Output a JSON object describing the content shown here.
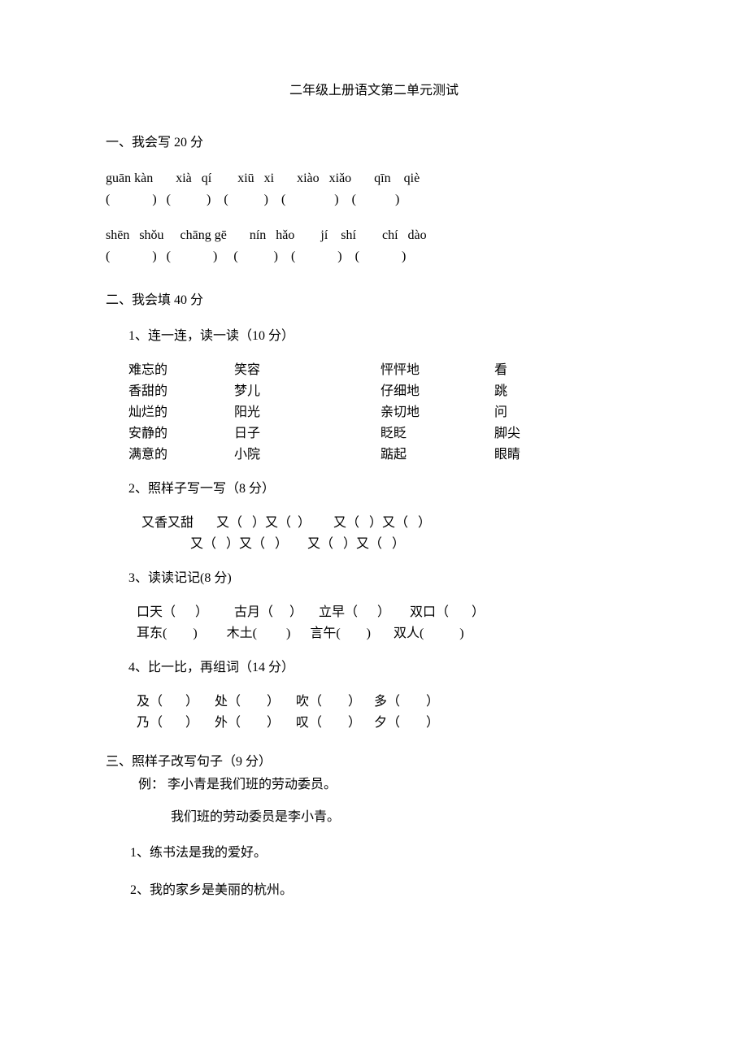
{
  "title": "二年级上册语文第二单元测试",
  "s1": {
    "heading": "一、我会写 20 分",
    "pinyin1": "guān kàn       xià   qí        xiū   xi       xiào   xiǎo       qīn    qiè",
    "blank1": "(             )   (           )    (           )    (               )    (            )",
    "pinyin2": "shēn   shǒu     chāng gē       nín   hǎo        jí    shí        chí   dào",
    "blank2": "(             )   (             )     (           )    (             )    (             )"
  },
  "s2": {
    "heading": "二、我会填  40 分",
    "q1": {
      "heading": "1、连一连，读一读（10 分）",
      "rows": [
        {
          "a": "难忘的",
          "b": "笑容",
          "c": "怦怦地",
          "d": "看"
        },
        {
          "a": "香甜的",
          "b": "梦儿",
          "c": "仔细地",
          "d": "跳"
        },
        {
          "a": "灿烂的",
          "b": "阳光",
          "c": "亲切地",
          "d": "问"
        },
        {
          "a": "安静的",
          "b": "日子",
          "c": "眨眨",
          "d": "脚尖"
        },
        {
          "a": "满意的",
          "b": "小院",
          "c": "踮起",
          "d": "眼睛"
        }
      ]
    },
    "q2": {
      "heading": "2、照样子写一写（8 分）",
      "line1": " 又香又甜       又（   ）又（  ）       又（   ）又（   ）",
      "line2": "                又（   ）又（   ）      又（   ）又（   ）"
    },
    "q3": {
      "heading": "3、读读记记(8 分)",
      "line1": "口天（      ）        古月（     ）     立早（      ）      双口（       ）",
      "line2": "耳东(        )         木土(         )      言午(        )       双人(           )"
    },
    "q4": {
      "heading": "4、比一比，再组词（14 分）",
      "line1": "及（       ）     处（        ）     吹（        ）    多（        ）",
      "line2": "乃（       ）     外（        ）     叹（        ）    夕（        ）"
    }
  },
  "s3": {
    "heading": "三、照样子改写句子（9 分）",
    "example_label": "例：  李小青是我们班的劳动委员。",
    "example_answer": "我们班的劳动委员是李小青。",
    "q1": "1、练书法是我的爱好。",
    "q2": "2、我的家乡是美丽的杭州。"
  }
}
